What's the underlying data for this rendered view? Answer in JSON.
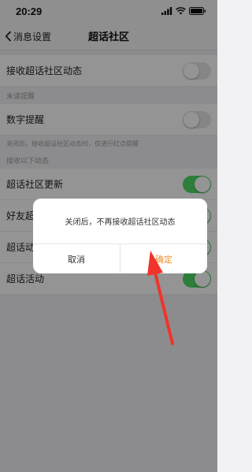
{
  "status_bar": {
    "time": "20:29"
  },
  "nav": {
    "back_label": "消息设置",
    "title": "超话社区"
  },
  "settings": {
    "receive_updates_label": "接收超话社区动态",
    "unread_header": "未读提醒",
    "digit_reminder_label": "数字提醒",
    "digit_reminder_note": "关闭后，接收超话社区动态时，仅进行红点提醒",
    "receive_following_header": "接收以下动态",
    "items": [
      {
        "label": "超话社区更新",
        "on": true
      },
      {
        "label": "好友超话动态",
        "on": true
      },
      {
        "label": "超话动态",
        "on": true
      },
      {
        "label": "超话活动",
        "on": true
      }
    ]
  },
  "dialog": {
    "message": "关闭后，不再接收超话社区动态",
    "cancel_label": "取消",
    "confirm_label": "确定"
  },
  "colors": {
    "toggle_on": "#4cd964",
    "toggle_off": "#e5e5ea",
    "confirm_text": "#f08c2b",
    "annotation_arrow": "#f0332c"
  },
  "icons": [
    "back-chevron-icon",
    "signal-icon",
    "wifi-icon",
    "battery-icon",
    "annotation-arrow-icon"
  ]
}
